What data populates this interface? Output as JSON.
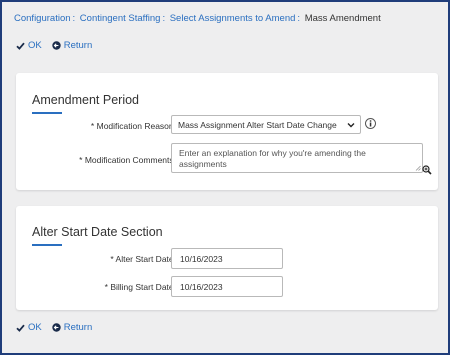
{
  "breadcrumb": {
    "items": [
      "Configuration",
      "Contingent Staffing",
      "Select Assignments to Amend"
    ],
    "separator": ":",
    "current": "Mass Amendment"
  },
  "actions": {
    "ok_label": "OK",
    "return_label": "Return"
  },
  "amendment_period": {
    "title": "Amendment Period",
    "modification_reason_label": "Modification Reason:",
    "modification_reason_value": "Mass Assignment Alter Start Date Change",
    "modification_comments_label": "Modification Comments:",
    "modification_comments_placeholder": "Enter an explanation for why you're amending the assignments"
  },
  "alter_start_date": {
    "title": "Alter Start Date Section",
    "alter_start_date_label": "Alter Start Date:",
    "alter_start_date_value": "10/16/2023",
    "billing_start_date_label": "Billing Start Date:",
    "billing_start_date_value": "10/16/2023"
  },
  "required_marker": "*",
  "colors": {
    "link": "#2a6fc0",
    "frame_border": "#1f3d7a",
    "background": "#eeeeef",
    "card": "#ffffff"
  }
}
